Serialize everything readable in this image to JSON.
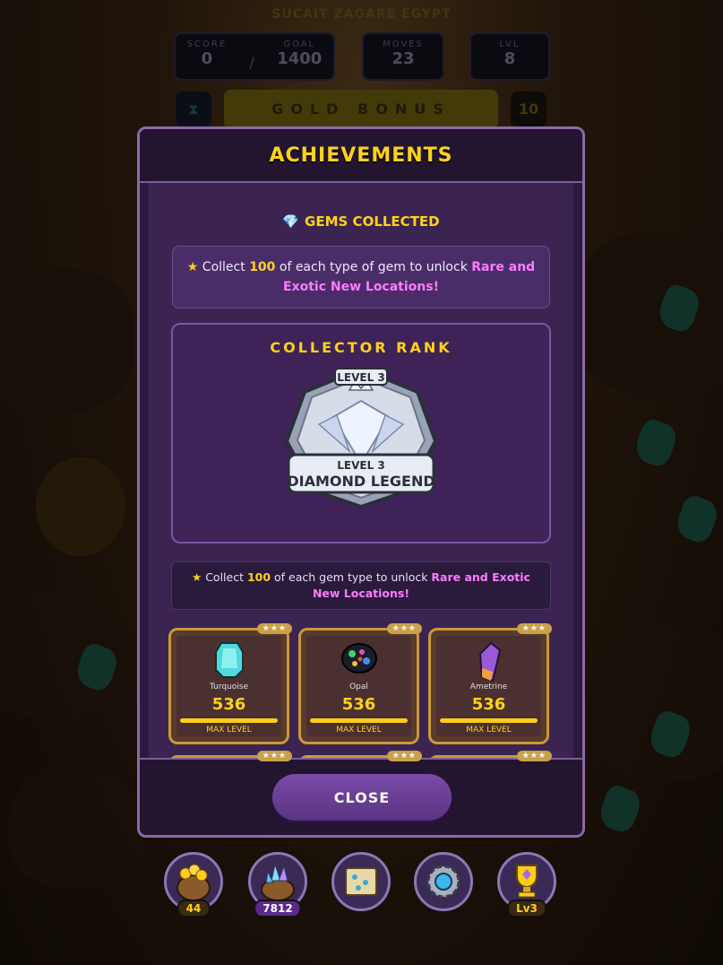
{
  "hud": {
    "location_title": "SUCAIT ZAGARE EGYPT",
    "score_label": "SCORE",
    "score_value": "0",
    "goal_label": "GOAL",
    "goal_value": "1400",
    "goal_separator": "/",
    "moves_label": "MOVES",
    "moves_value": "23",
    "level_label": "LVL",
    "level_value": "8",
    "gold_bonus_label": "GOLD BONUS",
    "gold_bonus_count": "10"
  },
  "modal": {
    "title": "ACHIEVEMENTS",
    "section_title": "GEMS COLLECTED",
    "info_top": {
      "prefix": " Collect ",
      "count": "100",
      "middle": " of each type of gem to unlock ",
      "highlight": "Rare and Exotic New Locations!"
    },
    "rank": {
      "title": "COLLECTOR RANK",
      "badge_level": "LEVEL 3",
      "badge_level_2": "LEVEL 3",
      "badge_name": "DIAMOND LEGEND"
    },
    "info_bottom": {
      "prefix": " Collect ",
      "count": "100",
      "middle": " of each gem type to unlock ",
      "highlight": "Rare and Exotic New Locations!"
    },
    "gems": [
      {
        "name": "Turquoise",
        "count": "536",
        "status": "MAX LEVEL",
        "stars": "★★★",
        "progress": 1.0
      },
      {
        "name": "Opal",
        "count": "536",
        "status": "MAX LEVEL",
        "stars": "★★★",
        "progress": 1.0
      },
      {
        "name": "Ametrine",
        "count": "536",
        "status": "MAX LEVEL",
        "stars": "★★★",
        "progress": 1.0
      }
    ],
    "next_row_stars": [
      "★★★",
      "★★★",
      "★★★"
    ],
    "close_label": "CLOSE"
  },
  "nav": {
    "gold_count": "44",
    "gems_count": "7812",
    "trophy_level": "Lv3"
  },
  "colors": {
    "accent_gold": "#ffd21a",
    "accent_pink": "#ff7cff",
    "panel_purple": "#3b2452"
  }
}
